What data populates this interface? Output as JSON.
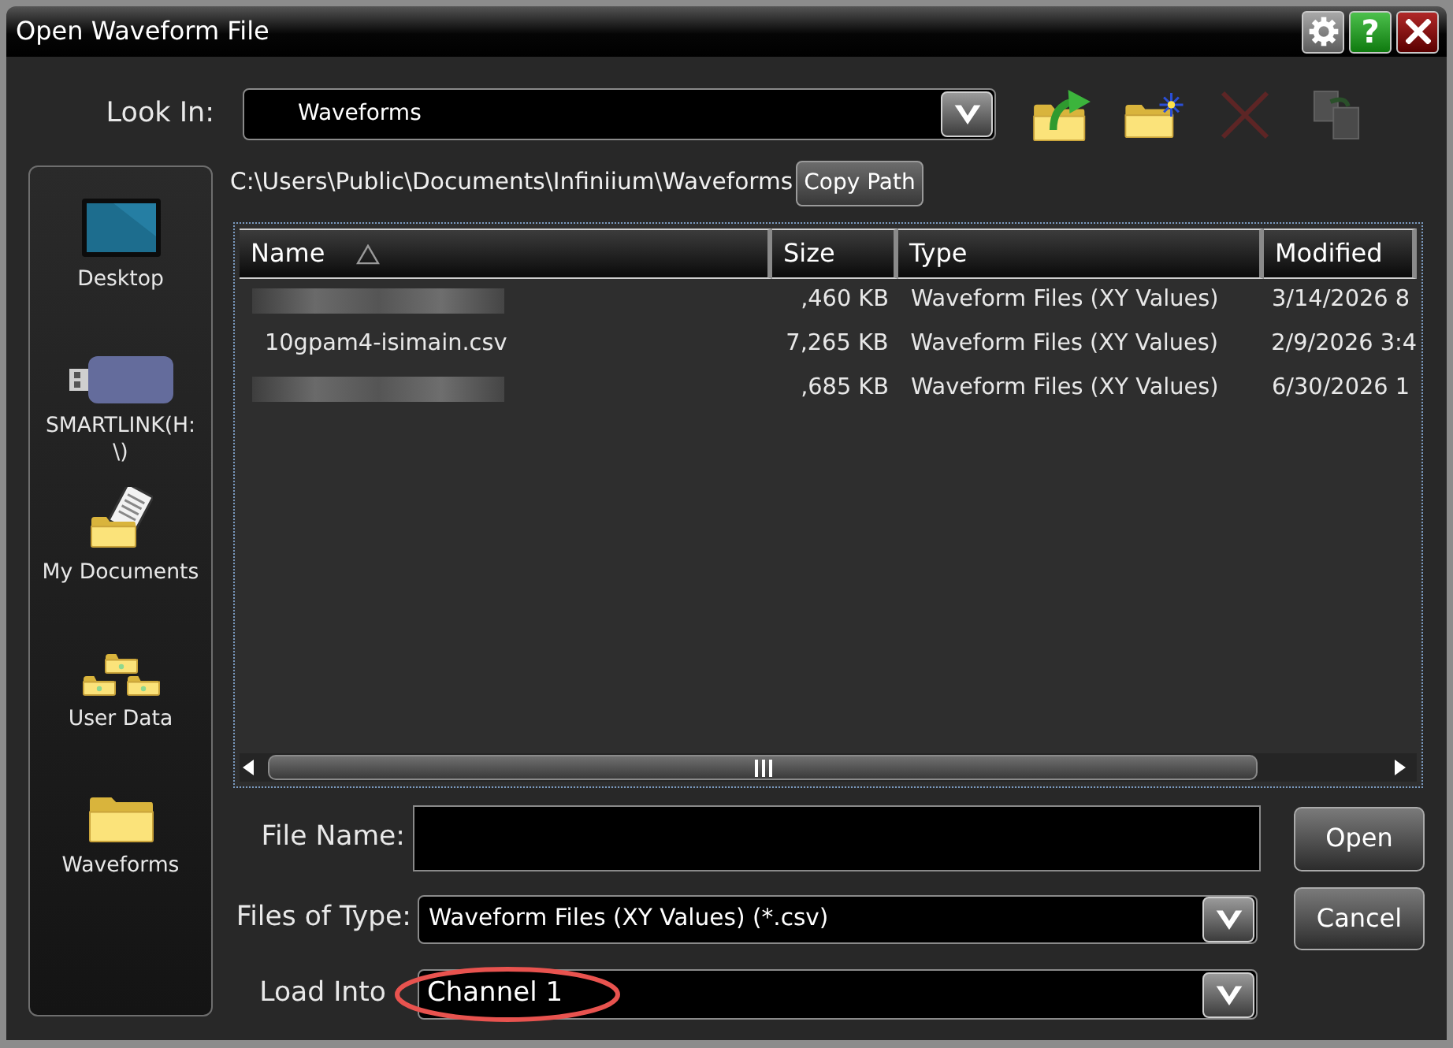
{
  "window": {
    "title": "Open Waveform File",
    "buttons": [
      {
        "kind": "settings"
      },
      {
        "kind": "help",
        "label": "?"
      },
      {
        "kind": "close"
      }
    ]
  },
  "look_in": {
    "label": "Look In:",
    "value": "Waveforms"
  },
  "toolbar": [
    {
      "kind": "up_folder",
      "disabled": false
    },
    {
      "kind": "new_folder",
      "disabled": false
    },
    {
      "kind": "delete",
      "disabled": true
    },
    {
      "kind": "rename",
      "disabled": true
    }
  ],
  "places": [
    {
      "kind": "desktop",
      "label": "Desktop"
    },
    {
      "kind": "usb_drive",
      "label": "SMARTLINK(H:\\)"
    },
    {
      "kind": "documents",
      "label": "My Documents"
    },
    {
      "kind": "user_data",
      "label": "User Data"
    },
    {
      "kind": "folder",
      "label": "Waveforms"
    }
  ],
  "path": {
    "text": "C:\\Users\\Public\\Documents\\Infiniium\\Waveforms",
    "button": "Copy Path"
  },
  "file_list": {
    "columns": [
      {
        "label": "Name",
        "sorted": true
      },
      {
        "label": "Size",
        "sorted": false
      },
      {
        "label": "Type",
        "sorted": false
      },
      {
        "label": "Modified",
        "sorted": false
      }
    ],
    "rows": [
      {
        "name_blurred": true,
        "size": ",460 KB",
        "type": "Waveform Files (XY Values)",
        "modified": "3/14/2026 8"
      },
      {
        "name_blurred": false,
        "name": "10gpam4-isimain.csv",
        "size": "7,265 KB",
        "type": "Waveform Files (XY Values)",
        "modified": "2/9/2026 3:4"
      },
      {
        "name_blurred": true,
        "size": ",685 KB",
        "type": "Waveform Files (XY Values)",
        "modified": "6/30/2026 1"
      }
    ]
  },
  "form": {
    "file_name": {
      "label": "File Name:"
    },
    "files_of_type": {
      "label": "Files of Type:",
      "value": "Waveform Files (XY Values) (*.csv)"
    },
    "load_into": {
      "label": "Load Into",
      "value": "Channel 1",
      "circled": true
    }
  },
  "buttons": [
    "Open",
    "Cancel"
  ]
}
